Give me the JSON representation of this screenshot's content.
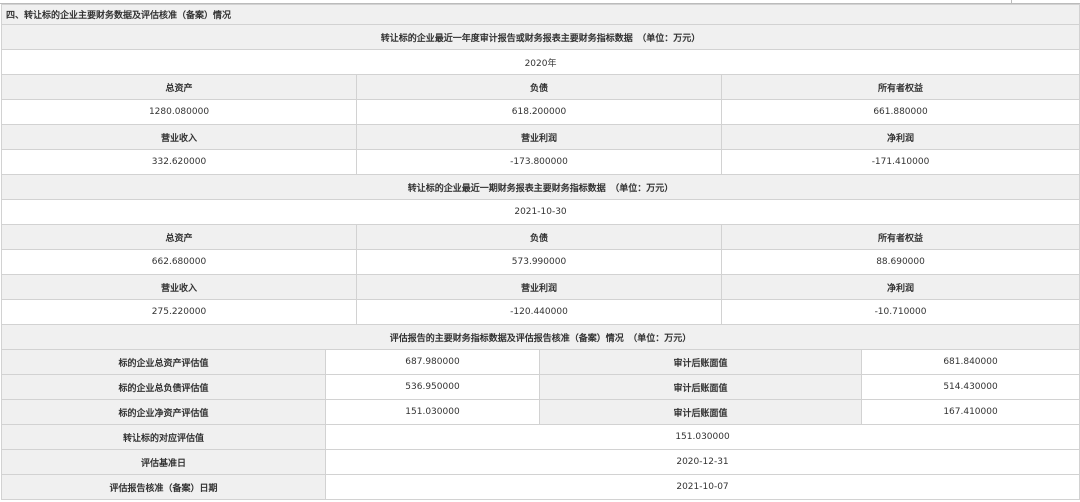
{
  "section_title": "四、转让标的企业主要财务数据及评估核准（备案）情况",
  "annual": {
    "caption": "转让标的企业最近一年度审计报告或财务报表主要财务指标数据　（单位：万元）",
    "period": "2020年",
    "labels_row1": [
      "总资产",
      "负债",
      "所有者权益"
    ],
    "values_row1": [
      "1280.080000",
      "618.200000",
      "661.880000"
    ],
    "labels_row2": [
      "营业收入",
      "营业利润",
      "净利润"
    ],
    "values_row2": [
      "332.620000",
      "-173.800000",
      "-171.410000"
    ]
  },
  "interim": {
    "caption": "转让标的企业最近一期财务报表主要财务指标数据　（单位：万元）",
    "period": "2021-10-30",
    "labels_row1": [
      "总资产",
      "负债",
      "所有者权益"
    ],
    "values_row1": [
      "662.680000",
      "573.990000",
      "88.690000"
    ],
    "labels_row2": [
      "营业收入",
      "营业利润",
      "净利润"
    ],
    "values_row2": [
      "275.220000",
      "-120.440000",
      "-10.710000"
    ]
  },
  "evaluation": {
    "caption": "评估报告的主要财务指标数据及评估报告核准（备案）情况　（单位：万元）",
    "rows": [
      {
        "label": "标的企业总资产评估值",
        "value": "687.980000",
        "label2": "审计后账面值",
        "value2": "681.840000"
      },
      {
        "label": "标的企业总负债评估值",
        "value": "536.950000",
        "label2": "审计后账面值",
        "value2": "514.430000"
      },
      {
        "label": "标的企业净资产评估值",
        "value": "151.030000",
        "label2": "审计后账面值",
        "value2": "167.410000"
      }
    ],
    "transfer_value_label": "转让标的对应评估值",
    "transfer_value": "151.030000",
    "base_date_label": "评估基准日",
    "base_date": "2020-12-31",
    "approval_date_label": "评估报告核准（备案）日期",
    "approval_date": "2021-10-07"
  }
}
